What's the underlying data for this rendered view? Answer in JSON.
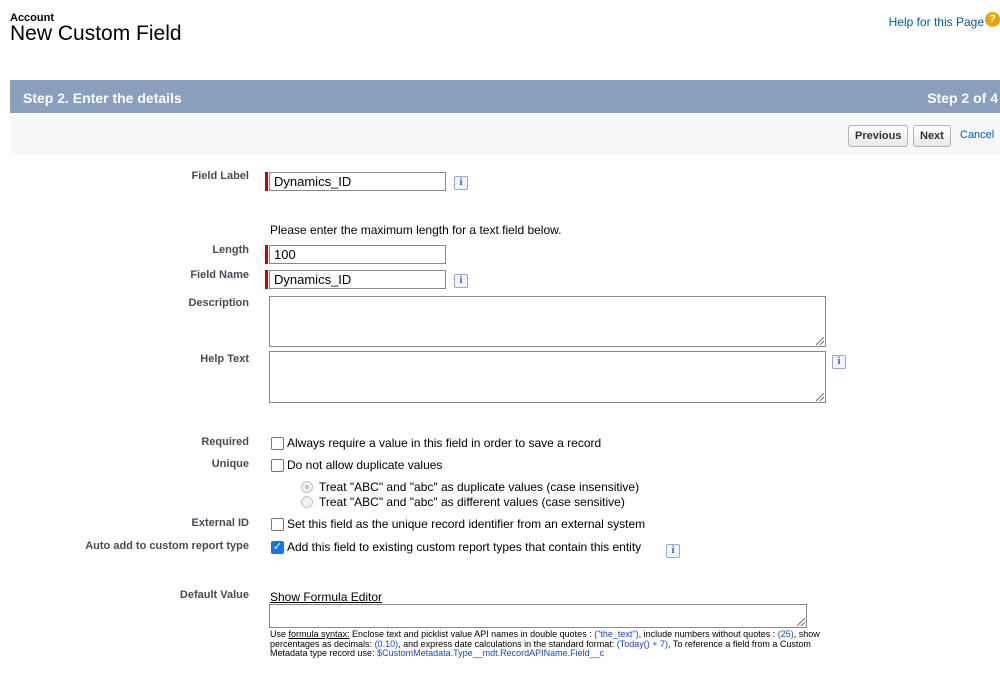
{
  "header": {
    "object_name": "Account",
    "title": "New Custom Field",
    "help_link": "Help for this Page",
    "help_icon": "help-icon"
  },
  "step": {
    "title": "Step 2. Enter the details",
    "count": "Step 2 of 4"
  },
  "buttons": {
    "previous": "Previous",
    "next": "Next",
    "cancel": "Cancel"
  },
  "form": {
    "field_label": {
      "label": "Field Label",
      "value": "Dynamics_ID"
    },
    "length_hint": "Please enter the maximum length for a text field below.",
    "length": {
      "label": "Length",
      "value": "100"
    },
    "field_name": {
      "label": "Field Name",
      "value": "Dynamics_ID"
    },
    "description": {
      "label": "Description",
      "value": ""
    },
    "help_text": {
      "label": "Help Text",
      "value": ""
    },
    "required": {
      "label": "Required",
      "text": "Always require a value in this field in order to save a record",
      "checked": false
    },
    "unique": {
      "label": "Unique",
      "text": "Do not allow duplicate values",
      "checked": false,
      "options": [
        "Treat \"ABC\" and \"abc\" as duplicate values (case insensitive)",
        "Treat \"ABC\" and \"abc\" as different values (case sensitive)"
      ]
    },
    "external_id": {
      "label": "External ID",
      "text": "Set this field as the unique record identifier from an external system",
      "checked": false
    },
    "auto_add": {
      "label": "Auto add to custom report type",
      "text": "Add this field to existing custom report types that contain this entity",
      "checked": true
    },
    "default_value": {
      "label": "Default Value",
      "formula_link": "Show Formula Editor",
      "help": {
        "p1": "Use ",
        "syntax": "formula syntax:",
        "p2": " Enclose text and picklist value API names in double quotes : ",
        "ex1": "(\"the_text\")",
        "p3": ", include numbers without quotes : ",
        "ex2": "(25)",
        "p4": ", show percentages as decimals: ",
        "ex3": "(0.10)",
        "p5": ", and express date calculations in the standard format: ",
        "ex4": "(Today() + 7)",
        "p6": ", To reference a field from a Custom Metadata type record use: ",
        "ex5": "$CustomMetadata.Type__mdt.RecordAPIName.Field__c"
      }
    }
  },
  "colors": {
    "step_header_bg": "#8a9ebe",
    "required_bar": "#cc0000",
    "link": "#015ba7",
    "checkbox_checked": "#1a73e8"
  }
}
